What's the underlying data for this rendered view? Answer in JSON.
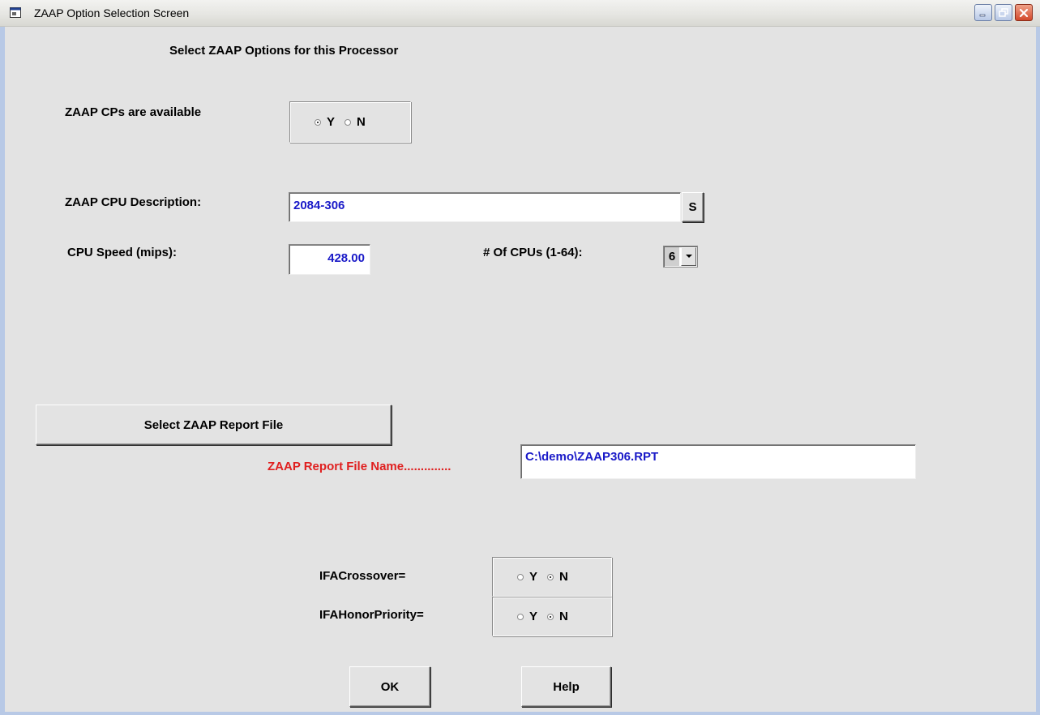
{
  "window": {
    "title": "ZAAP Option Selection Screen"
  },
  "header": {
    "heading": "Select ZAAP Options for this Processor"
  },
  "zaap_cps": {
    "label": "ZAAP CPs are available",
    "options": [
      "Y",
      "N"
    ],
    "selected": "Y"
  },
  "cpu_description": {
    "label": "ZAAP CPU Description:",
    "value": "2084-306",
    "lookup_button": "S"
  },
  "cpu_speed": {
    "label": "CPU Speed (mips):",
    "value": "428.00"
  },
  "num_cpus": {
    "label": "# Of CPUs (1-64):",
    "value": "6"
  },
  "report": {
    "select_button": "Select ZAAP Report File",
    "file_name_label": "ZAAP Report File Name..............",
    "file_name_value": "C:\\demo\\ZAAP306.RPT"
  },
  "ifa_crossover": {
    "label": "IFACrossover=",
    "options": [
      "Y",
      "N"
    ],
    "selected": "N"
  },
  "ifa_honor_priority": {
    "label": "IFAHonorPriority=",
    "options": [
      "Y",
      "N"
    ],
    "selected": "N"
  },
  "buttons": {
    "ok": "OK",
    "help": "Help"
  },
  "colors": {
    "label_red": "#e02020",
    "value_blue": "#1a1ac8",
    "background": "#e3e3e3"
  }
}
